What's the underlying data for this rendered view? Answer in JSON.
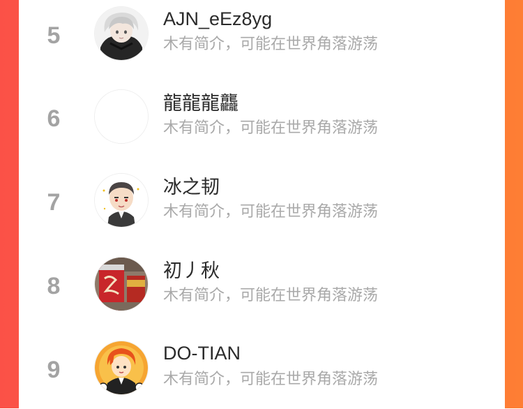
{
  "colors": {
    "background_gradient_start": "#fb5147",
    "background_gradient_end": "#fe7e34",
    "card": "#ffffff",
    "rank_text": "#a3a3a3",
    "name_text": "#2b2b2b",
    "bio_text": "#a9a9a9"
  },
  "ranking": {
    "users": [
      {
        "rank": "5",
        "name": "AJN_eEz8yg",
        "bio": "木有简介，可能在世界角落游荡",
        "avatar_icon": "anime-boy-avatar"
      },
      {
        "rank": "6",
        "name": "龍龍龍龘",
        "bio": "木有简介，可能在世界角落游荡",
        "avatar_icon": "blank-avatar"
      },
      {
        "rank": "7",
        "name": "冰之韧",
        "bio": "木有简介，可能在世界角落游荡",
        "avatar_icon": "cartoon-man-avatar"
      },
      {
        "rank": "8",
        "name": "初丿秋",
        "bio": "木有简介，可能在世界角落游荡",
        "avatar_icon": "red-can-avatar"
      },
      {
        "rank": "9",
        "name": "DO-TIAN",
        "bio": "木有简介，可能在世界角落游荡",
        "avatar_icon": "cartoon-orange-hair-avatar"
      }
    ]
  }
}
